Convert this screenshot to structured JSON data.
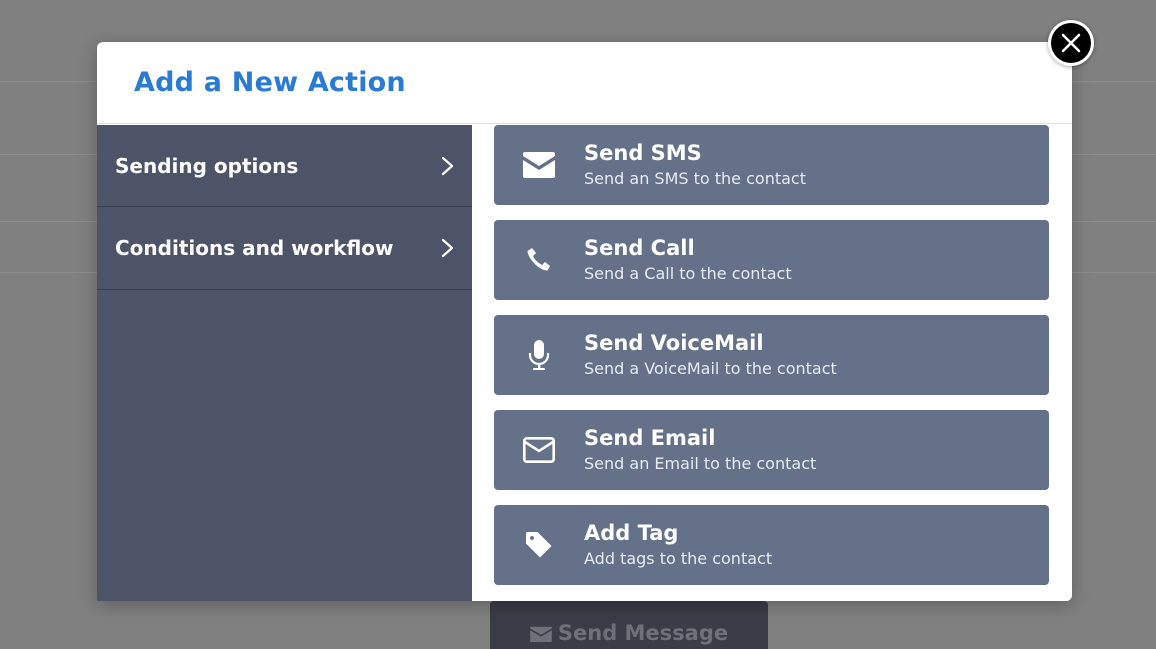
{
  "background": {
    "send_button_label": "Send Message"
  },
  "modal": {
    "title": "Add a New Action",
    "categories": [
      {
        "label": "Sending options",
        "icon": "chevron-right-icon"
      },
      {
        "label": "Conditions and workflow",
        "icon": "chevron-right-icon"
      }
    ],
    "actions": [
      {
        "title": "Send SMS",
        "description": "Send an SMS to the contact",
        "icon": "envelope-icon"
      },
      {
        "title": "Send Call",
        "description": "Send a Call to the contact",
        "icon": "phone-icon"
      },
      {
        "title": "Send VoiceMail",
        "description": "Send a VoiceMail to the contact",
        "icon": "microphone-icon"
      },
      {
        "title": "Send Email",
        "description": "Send an Email to the contact",
        "icon": "envelope-outline-icon"
      },
      {
        "title": "Add Tag",
        "description": "Add tags to the contact",
        "icon": "tag-icon"
      }
    ],
    "close_icon": "close-icon"
  },
  "colors": {
    "title": "#2a7bd3",
    "sidebar": "#4e5468",
    "action_card": "#647189",
    "overlay": "#808080"
  }
}
